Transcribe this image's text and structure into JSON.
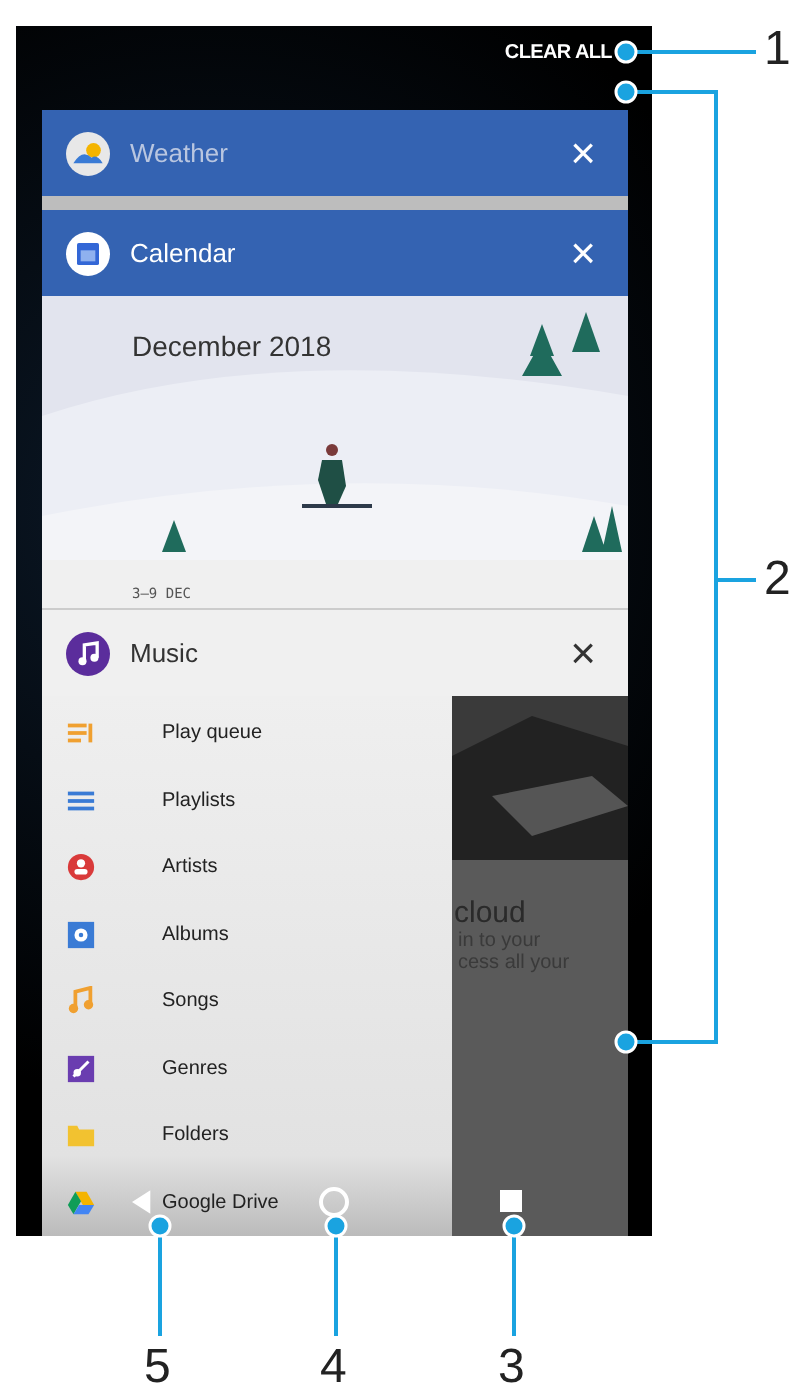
{
  "clear_all": "CLEAR ALL",
  "cards": [
    {
      "kind": "header",
      "app": "Weather",
      "close": "×"
    },
    {
      "kind": "calendar",
      "app": "Calendar",
      "close": "×",
      "title": "December 2018",
      "week": "3–9 DEC"
    },
    {
      "kind": "music",
      "app": "Music",
      "close": "×",
      "items": [
        {
          "label": "Play queue"
        },
        {
          "label": "Playlists"
        },
        {
          "label": "Artists"
        },
        {
          "label": "Albums"
        },
        {
          "label": "Songs"
        },
        {
          "label": "Genres"
        },
        {
          "label": "Folders"
        },
        {
          "label": "Google Drive"
        }
      ],
      "panel_title": "cloud",
      "panel_lines": [
        "in to your",
        "cess all your"
      ]
    }
  ],
  "callouts": [
    "1",
    "2",
    "5",
    "4",
    "3"
  ]
}
